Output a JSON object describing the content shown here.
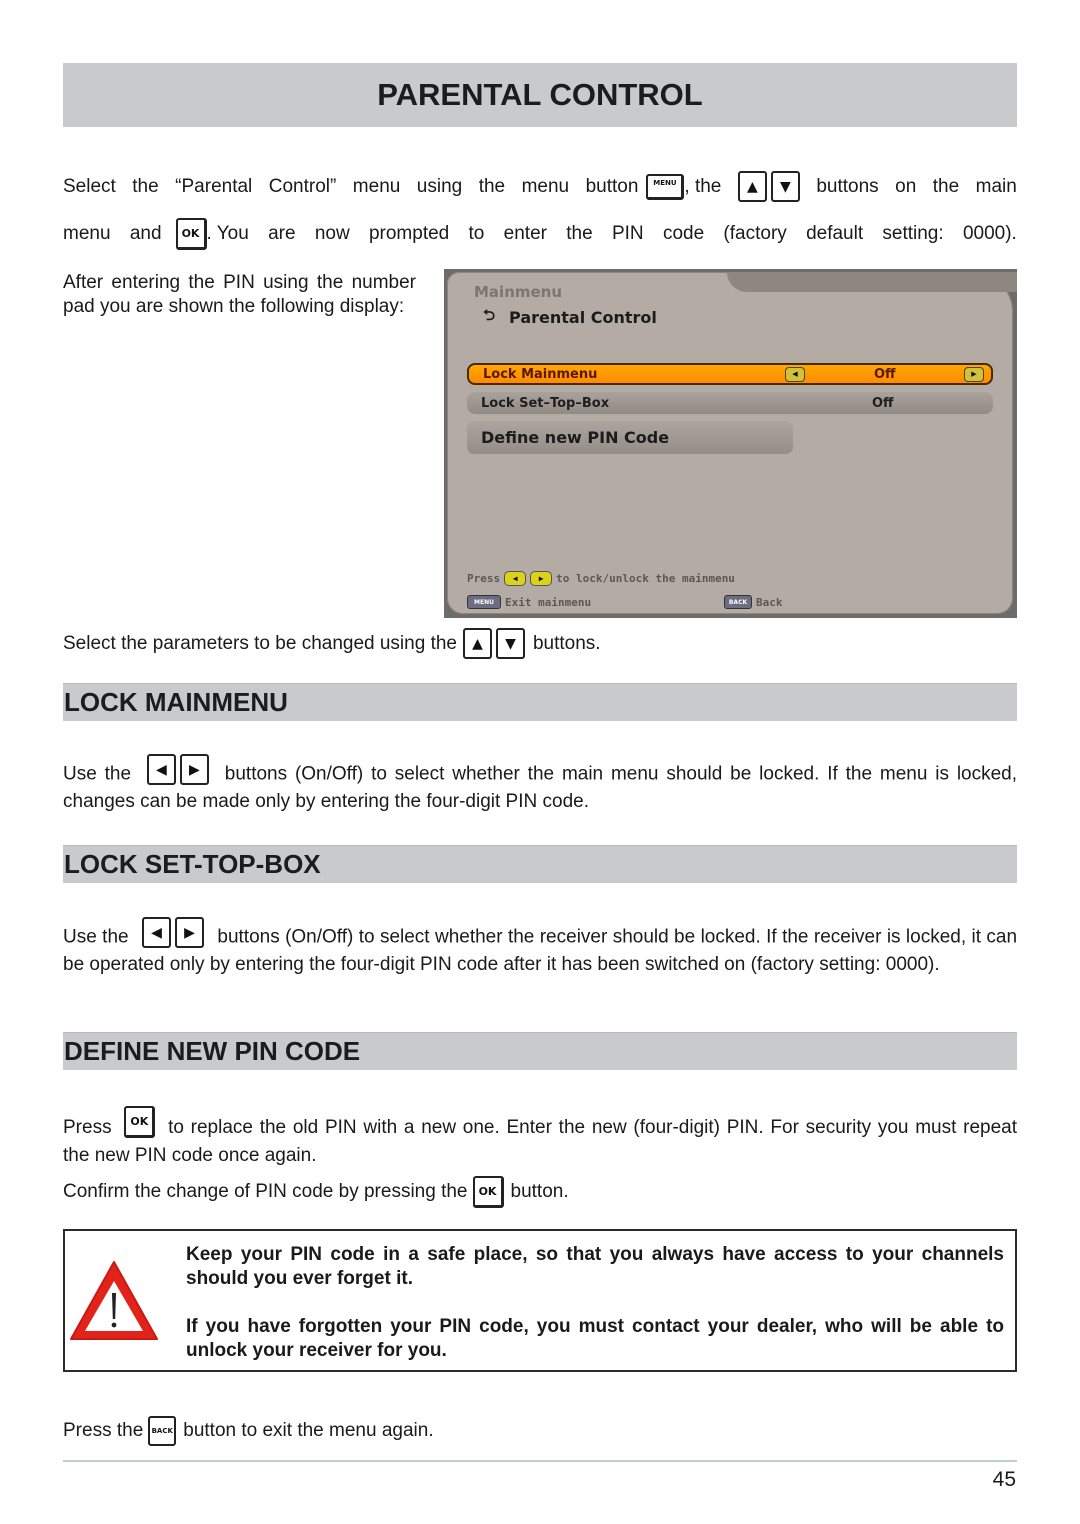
{
  "page": {
    "title": "PARENTAL CONTROL",
    "page_number": "45"
  },
  "keys": {
    "menu": "MENU",
    "ok": "OK",
    "up": "▲",
    "down": "▼",
    "left": "◀",
    "right": "▶",
    "back": "BACK"
  },
  "intro": {
    "line1_words": [
      "Select",
      "the",
      "“Parental",
      "Control”",
      "menu",
      "using",
      "the",
      "menu",
      "button"
    ],
    "line1_mid": ", the",
    "line1_tail_words": [
      "buttons",
      "on",
      "the",
      "main"
    ],
    "line2_pre_words": [
      "menu",
      "and"
    ],
    "line2_post_words": [
      ". You",
      "are",
      "now",
      "prompted",
      "to",
      "enter",
      "the",
      "PIN",
      "code",
      "(factory",
      "default",
      "setting:",
      "0000)."
    ],
    "after_pin": "After entering the PIN using the number pad you are shown the following display:",
    "select_params_pre": "Select the parameters to be changed using the",
    "select_params_post": "buttons."
  },
  "tv_screen": {
    "breadcrumb": "Mainmenu",
    "title": "Parental Control",
    "title_icon": "return-arrow-icon",
    "rows": [
      {
        "label": "Lock Mainmenu",
        "value": "Off",
        "selected": true
      },
      {
        "label": "Lock Set–Top–Box",
        "value": "Off",
        "selected": false
      }
    ],
    "action_button": "Define new PIN Code",
    "hint_press": "Press",
    "hint_action": "to lock/unlock the mainmenu",
    "menu_key": "MENU",
    "menu_hint": "Exit mainmenu",
    "back_key": "BACK",
    "back_hint": "Back",
    "colors": {
      "selected_row": "#ff9a00",
      "panel": "#b3aba4"
    }
  },
  "sections": [
    {
      "heading": "LOCK MAINMENU",
      "pre": "Use the",
      "text": "buttons (On/Off) to select whether the main menu should be locked. If the menu is locked, changes can be made only by entering the four-digit PIN code."
    },
    {
      "heading": "LOCK SET-TOP-BOX",
      "pre": "Use the",
      "text": "buttons (On/Off) to select whether the receiver should be locked. If the receiver is locked, it can be operated only by entering the four-digit PIN code after it has been switched on (factory setting: 0000)."
    },
    {
      "heading": "DEFINE NEW PIN CODE",
      "pre": "Press",
      "text": "to replace the old PIN with a new one. Enter the new (four-digit) PIN. For security you must repeat the new PIN code once again.",
      "confirm_pre": "Confirm the change of PIN code by pressing the",
      "confirm_post": "button."
    }
  ],
  "warning": {
    "icon": "warning-triangle-icon",
    "para1": "Keep your PIN code in a safe place, so that you always have access to your channels should you ever forget it.",
    "para2": "If you have forgotten your PIN code, you must contact your dealer, who will be able to unlock your receiver for you.",
    "icon_color": "#e2231a"
  },
  "exit_note": {
    "pre": "Press the",
    "post": "button to exit the menu again."
  }
}
